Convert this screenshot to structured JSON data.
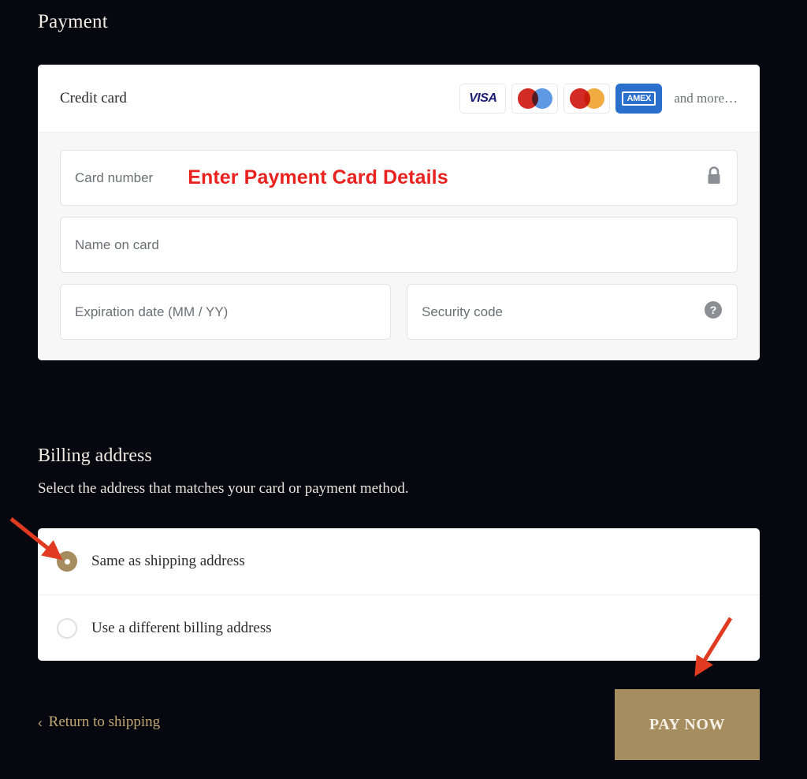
{
  "page": {
    "title": "Payment"
  },
  "payment_panel": {
    "header_label": "Credit card",
    "brands": [
      {
        "name": "visa-logo",
        "text": "VISA"
      },
      {
        "name": "maestro-logo",
        "left_color": "#d32b26",
        "right_color": "#4f8ee0"
      },
      {
        "name": "mastercard-logo",
        "left_color": "#d32b26",
        "right_color": "#f0a22e"
      },
      {
        "name": "amex-logo",
        "text": "AMEX",
        "bg": "#2a6fcb"
      }
    ],
    "and_more": "and more…",
    "fields": {
      "card_number_placeholder": "Card number",
      "card_number_value": "",
      "name_placeholder": "Name on card",
      "name_value": "",
      "expiration_placeholder": "Expiration date (MM / YY)",
      "expiration_value": "",
      "security_placeholder": "Security code",
      "security_value": ""
    },
    "annotation": "Enter Payment Card Details"
  },
  "billing": {
    "title": "Billing address",
    "subtitle": "Select the address that matches your card or payment method.",
    "options": [
      {
        "label": "Same as shipping address",
        "selected": true
      },
      {
        "label": "Use a different billing address",
        "selected": false
      }
    ]
  },
  "footer": {
    "return_chevron": "‹",
    "return_label": "Return to shipping",
    "pay_label": "PAY NOW"
  },
  "colors": {
    "background": "#07070f",
    "accent_gold": "#a68d5f",
    "link_gold": "#c0a875",
    "annotation_red": "#e8231f",
    "panel_white": "#ffffff",
    "form_gray": "#f7f7f8"
  }
}
